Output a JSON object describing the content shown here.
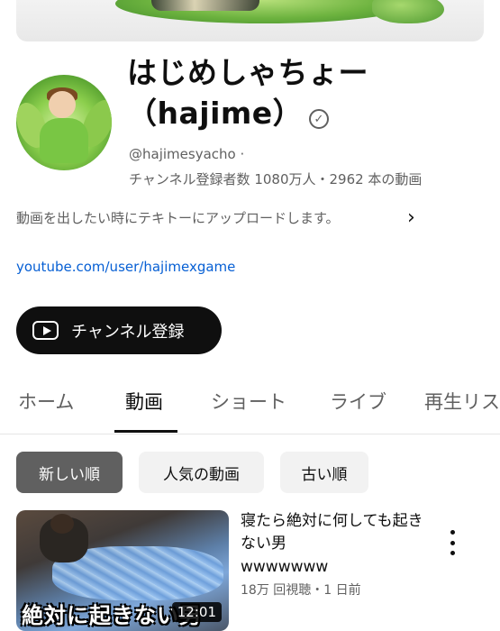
{
  "channel": {
    "name_line1": "はじめしゃちょー",
    "name_line2": "（hajime）",
    "handle": "@hajimesyacho ·",
    "stats": "チャンネル登録者数 1080万人・2962 本の動画",
    "description": "動画を出したい時にテキトーにアップロードします。",
    "link": "youtube.com/user/hajimexgame",
    "subscribe_label": "チャンネル登録",
    "verified_icon": "checkmark-circle-icon"
  },
  "tabs": [
    {
      "label": "ホーム"
    },
    {
      "label": "動画"
    },
    {
      "label": "ショート"
    },
    {
      "label": "ライブ"
    },
    {
      "label": "再生リスト"
    }
  ],
  "active_tab": "動画",
  "sort_chips": [
    {
      "label": "新しい順"
    },
    {
      "label": "人気の動画"
    },
    {
      "label": "古い順"
    }
  ],
  "active_chip": "新しい順",
  "video": {
    "title": "寝たら絶対に何しても起きない男",
    "subtitle": "wwwwwww",
    "meta": "18万 回視聴・1 日前",
    "duration": "12:01",
    "thumbnail_caption": "絶対に起きない男"
  },
  "colors": {
    "accent_link": "#065fd4",
    "subscribe_bg": "#0f0f0f",
    "chip_active_bg": "#606060",
    "chip_bg": "#f2f2f2"
  }
}
